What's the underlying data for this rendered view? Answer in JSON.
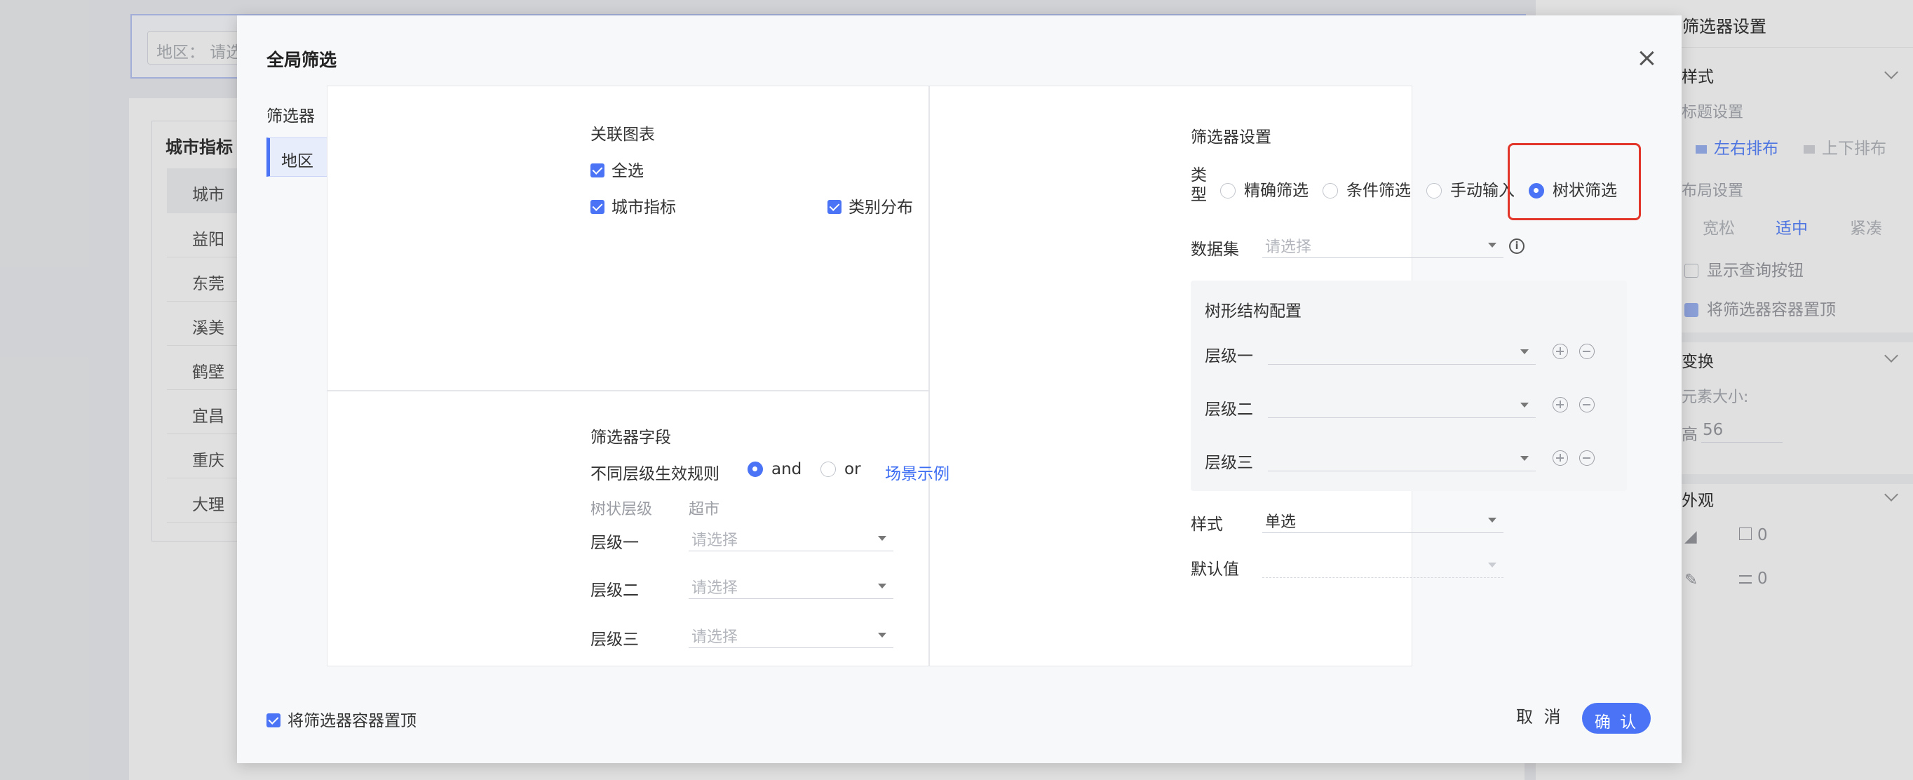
{
  "background": {
    "filter_input_placeholder": "地区： 请选",
    "card_title": "城市指标",
    "table_header": "城市",
    "table_rows": [
      "益阳",
      "东莞",
      "溪美",
      "鹤壁",
      "宜昌",
      "重庆",
      "大理"
    ]
  },
  "right_panel": {
    "title": "筛选器设置",
    "style_section": "样式",
    "title_settings_label": "标题设置",
    "layout_lr": "左右排布",
    "layout_tb": "上下排布",
    "layout_settings_label": "布局设置",
    "layout_loose": "宽松",
    "layout_fit": "适中",
    "layout_compact": "紧凑",
    "show_query_button": "显示查询按钮",
    "pin_container_top": "将筛选器容器置顶",
    "transform_section": "变换",
    "element_size_label": "元素大小:",
    "height_label": "高",
    "height_value": "56",
    "appearance_section": "外观",
    "fill_value": "0",
    "border_value": "0"
  },
  "modal": {
    "title": "全局筛选",
    "filter_list_title": "筛选器",
    "filters": [
      "地区"
    ],
    "linked_charts": {
      "title": "关联图表",
      "select_all": "全选",
      "charts": [
        "城市指标",
        "类别分布"
      ]
    },
    "filter_fields": {
      "title": "筛选器字段",
      "rule_label": "不同层级生效规则",
      "rule_and": "and",
      "rule_or": "or",
      "scenario_link": "场景示例",
      "col_tree_level": "树状层级",
      "col_dataset": "超市",
      "levels": [
        {
          "label": "层级一",
          "placeholder": "请选择"
        },
        {
          "label": "层级二",
          "placeholder": "请选择"
        },
        {
          "label": "层级三",
          "placeholder": "请选择"
        }
      ]
    },
    "settings": {
      "title": "筛选器设置",
      "type_label_1": "类",
      "type_label_2": "型",
      "types": [
        "精确筛选",
        "条件筛选",
        "手动输入",
        "树状筛选"
      ],
      "selected_type": "树状筛选",
      "dataset_label": "数据集",
      "dataset_placeholder": "请选择",
      "tree_config_title": "树形结构配置",
      "tree_levels": [
        "层级一",
        "层级二",
        "层级三"
      ],
      "style_label": "样式",
      "style_value": "单选",
      "default_label": "默认值"
    },
    "footer": {
      "pin_top": "将筛选器容器置顶",
      "cancel": "取 消",
      "confirm": "确 认"
    }
  },
  "colors": {
    "primary": "#4a74f5",
    "highlight": "#e2362b"
  }
}
